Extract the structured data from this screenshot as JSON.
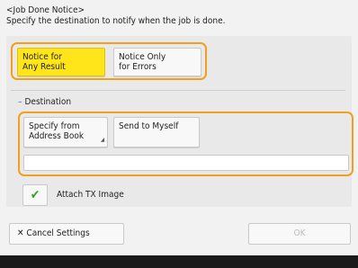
{
  "header": {
    "title": "<Job Done Notice>",
    "subtitle": "Specify the destination to notify when the job is done."
  },
  "notice": {
    "any_result_line1": "Notice for",
    "any_result_line2": "Any Result",
    "errors_line1": "Notice Only",
    "errors_line2": "for Errors",
    "selected": "any_result"
  },
  "destination": {
    "label": "Destination",
    "address_book_line1": "Specify from",
    "address_book_line2": "Address Book",
    "send_to_myself": "Send to Myself",
    "value": ""
  },
  "attach": {
    "label": "Attach TX Image",
    "checked": true
  },
  "footer": {
    "cancel": "Cancel Settings",
    "ok": "OK"
  },
  "colors": {
    "selected": "#ffe51a",
    "highlight": "#f0a01c",
    "check": "#3aa12a"
  }
}
